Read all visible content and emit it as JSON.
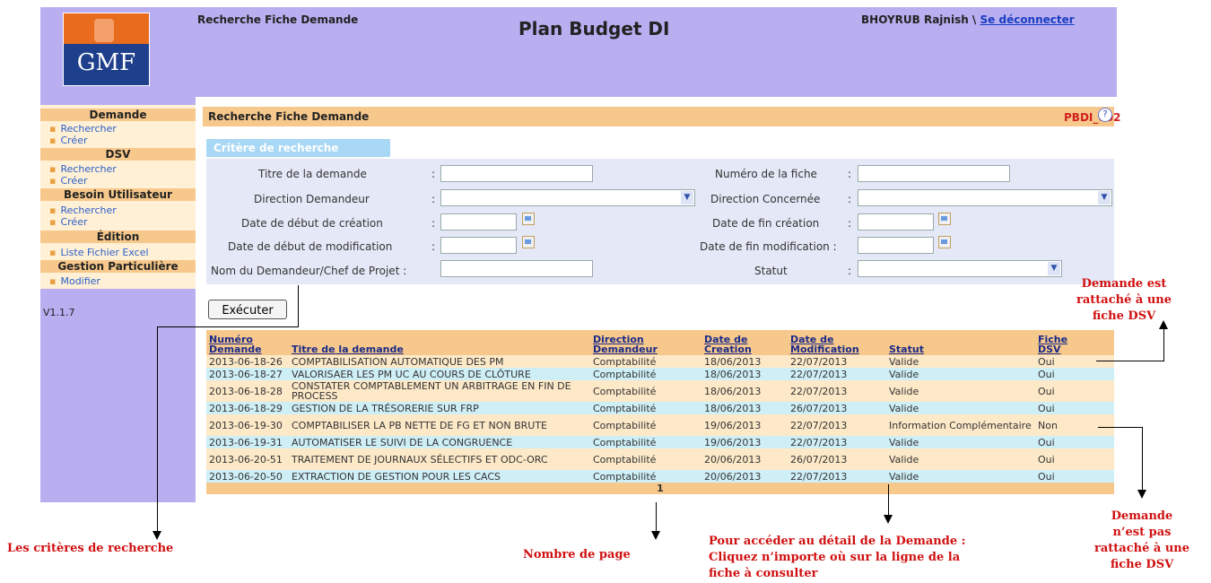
{
  "header": {
    "breadcrumb": "Recherche Fiche Demande",
    "app_title": "Plan Budget DI",
    "user": "BHOYRUB Rajnish \\",
    "logout": "Se déconnecter",
    "logo_text": "GMF"
  },
  "sidebar": {
    "sections": [
      {
        "title": "Demande",
        "items": [
          "Rechercher",
          "Créer"
        ]
      },
      {
        "title": "DSV",
        "items": [
          "Rechercher",
          "Créer"
        ]
      },
      {
        "title": "Besoin Utilisateur",
        "items": [
          "Rechercher",
          "Créer"
        ]
      },
      {
        "title": "Édition",
        "items": [
          "Liste Fichier Excel"
        ]
      },
      {
        "title": "Gestion Particulière",
        "items": [
          "Modifier"
        ]
      }
    ],
    "version": "V1.1.7"
  },
  "main": {
    "title": "Recherche Fiche Demande",
    "page_code": "PBDI_002",
    "help": "?",
    "criteria_tab": "Critère de recherche",
    "fields": {
      "titre": "Titre de la demande",
      "numero": "Numéro de la fiche",
      "dir_dem": "Direction Demandeur",
      "dir_conc": "Direction Concernée",
      "date_deb_crea": "Date de début de création",
      "date_fin_crea": "Date de fin création",
      "date_deb_modif": "Date de début de modification",
      "date_fin_modif": "Date de fin modification :",
      "nom_dem": "Nom du Demandeur/Chef de Projet :",
      "statut": "Statut",
      "colon": ":"
    },
    "execute": "Exécuter"
  },
  "table": {
    "headers": {
      "num1": "Numéro",
      "num2": "Demande",
      "titre": "Titre de la demande",
      "dir1": "Direction",
      "dir2": "Demandeur",
      "dc1": "Date de",
      "dc2": "Creation",
      "dm1": "Date de",
      "dm2": "Modification",
      "statut": "Statut",
      "fiche1": "Fiche",
      "fiche2": "DSV"
    },
    "rows": [
      {
        "num": "2013-06-18-26",
        "titre": "COMPTABILISATION AUTOMATIQUE DES PM",
        "dir": "Comptabilité",
        "dc": "18/06/2013",
        "dm": "22/07/2013",
        "statut": "Valide",
        "dsv": "Oui"
      },
      {
        "num": "2013-06-18-27",
        "titre": "VALORISAER LES PM UC AU COURS DE CLÔTURE",
        "dir": "Comptabilité",
        "dc": "18/06/2013",
        "dm": "22/07/2013",
        "statut": "Valide",
        "dsv": "Oui"
      },
      {
        "num": "2013-06-18-28",
        "titre": "CONSTATER COMPTABLEMENT UN ARBITRAGE EN FIN DE PROCESS",
        "dir": "Comptabilité",
        "dc": "18/06/2013",
        "dm": "22/07/2013",
        "statut": "Valide",
        "dsv": "Oui"
      },
      {
        "num": "2013-06-18-29",
        "titre": "GESTION DE LA TRÉSORERIE SUR FRP",
        "dir": "Comptabilité",
        "dc": "18/06/2013",
        "dm": "26/07/2013",
        "statut": "Valide",
        "dsv": "Oui"
      },
      {
        "num": "2013-06-19-30",
        "titre": "COMPTABILISER LA PB NETTE DE FG ET NON BRUTE",
        "dir": "Comptabilité",
        "dc": "19/06/2013",
        "dm": "22/07/2013",
        "statut": "Information Complémentaire",
        "dsv": "Non"
      },
      {
        "num": "2013-06-19-31",
        "titre": "AUTOMATISER LE SUIVI DE LA CONGRUENCE",
        "dir": "Comptabilité",
        "dc": "19/06/2013",
        "dm": "22/07/2013",
        "statut": "Valide",
        "dsv": "Oui"
      },
      {
        "num": "2013-06-20-51",
        "titre": "TRAITEMENT DE JOURNAUX SÉLECTIFS ET ODC-ORC",
        "dir": "Comptabilité",
        "dc": "20/06/2013",
        "dm": "26/07/2013",
        "statut": "Valide",
        "dsv": "Oui"
      },
      {
        "num": "2013-06-20-50",
        "titre": "EXTRACTION DE GESTION POUR LES CACS",
        "dir": "Comptabilité",
        "dc": "20/06/2013",
        "dm": "22/07/2013",
        "statut": "Valide",
        "dsv": "Oui"
      }
    ],
    "page": "1"
  },
  "annotations": {
    "criteres": "Les critères de recherche",
    "nombre_page": "Nombre de page",
    "acceder": [
      "Pour accéder au détail de la Demande :",
      "Cliquez n’importe où sur la ligne de la",
      "fiche à consulter"
    ],
    "rattache": [
      "Demande est",
      "rattaché à une",
      "fiche DSV"
    ],
    "non_rattache": [
      "Demande",
      "n’est pas",
      "rattaché à une",
      "fiche DSV"
    ]
  },
  "colors": {
    "header_bg": "#b8aef0",
    "orange_bar": "#f7c88b",
    "annotation_red": "#d01010",
    "page_code_red": "#d02020"
  }
}
